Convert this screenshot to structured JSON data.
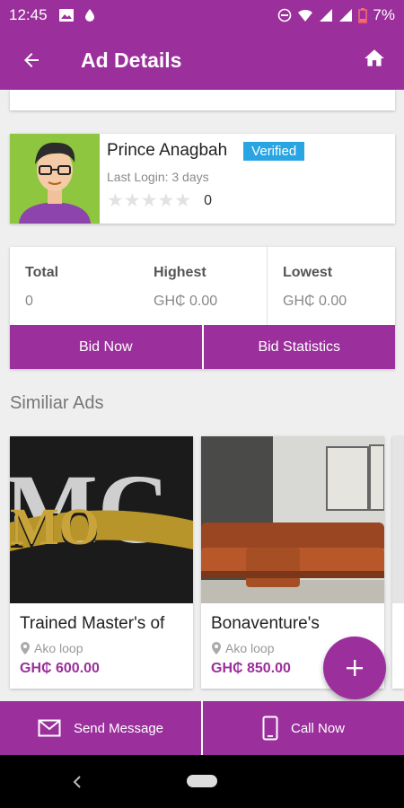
{
  "status": {
    "time": "12:45",
    "battery": "7%"
  },
  "appbar": {
    "title": "Ad Details"
  },
  "seller": {
    "name": "Prince Anagbah",
    "badge": "Verified",
    "last_login": "Last Login: 3 days",
    "rating_count": "0"
  },
  "bids": {
    "total_label": "Total",
    "total_value": "0",
    "highest_label": "Highest",
    "highest_value": "GH₵ 0.00",
    "lowest_label": "Lowest",
    "lowest_value": "GH₵ 0.00",
    "bid_now": "Bid Now",
    "bid_statistics": "Bid Statistics"
  },
  "similar": {
    "title": "Similiar Ads",
    "items": [
      {
        "title": "Trained Master's of",
        "location": "Ako loop",
        "price": "GH₵ 600.00"
      },
      {
        "title": "Bonaventure's",
        "location": "Ako loop",
        "price": "GH₵ 850.00"
      }
    ]
  },
  "bottom": {
    "send_message": "Send Message",
    "call_now": "Call Now"
  },
  "colors": {
    "primary": "#9b2f9c",
    "verified": "#29a5e3",
    "avatar_bg": "#8ec63f"
  }
}
